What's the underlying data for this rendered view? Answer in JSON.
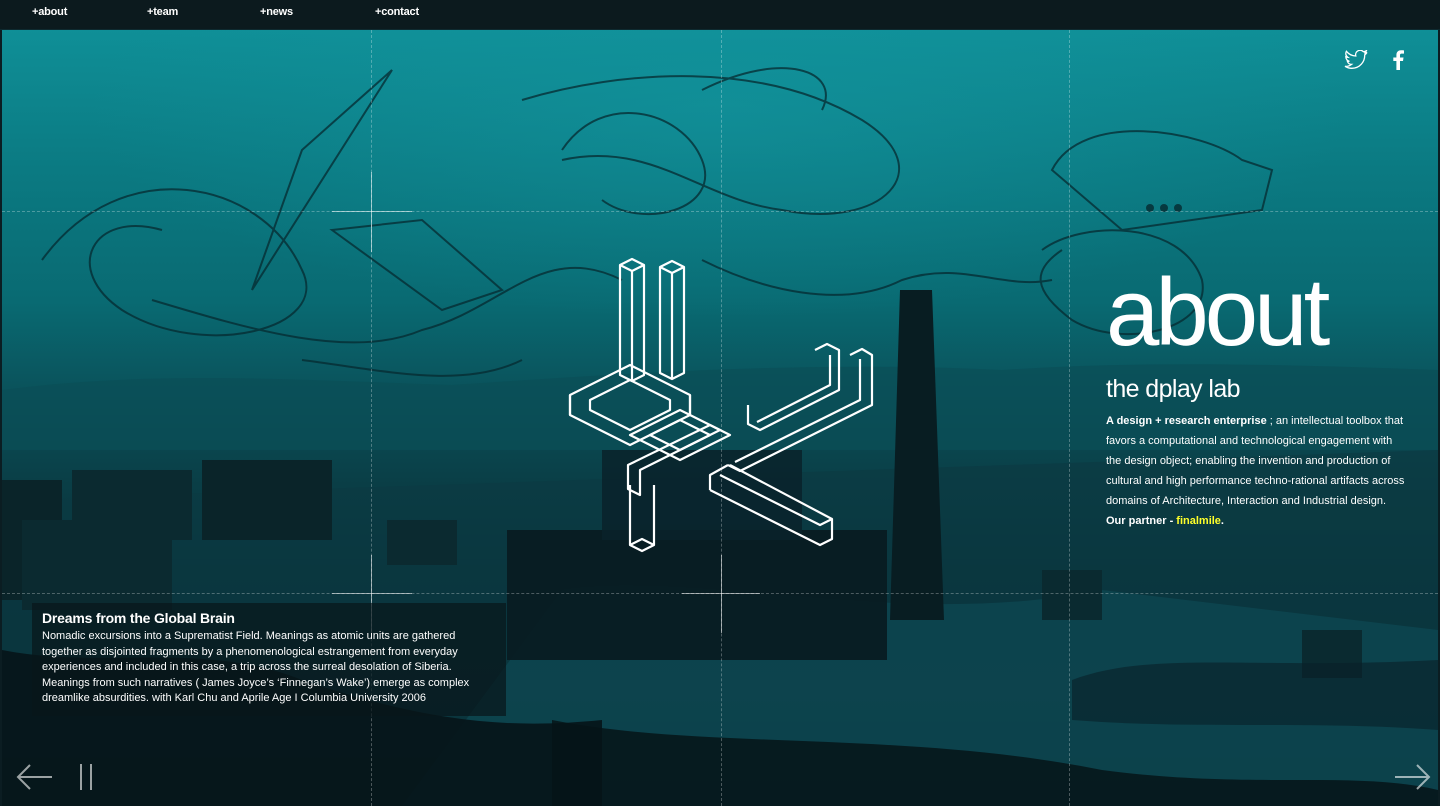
{
  "nav": {
    "items": [
      {
        "label": "+about"
      },
      {
        "label": "+team"
      },
      {
        "label": "+news"
      },
      {
        "label": "+contact"
      }
    ]
  },
  "social": {
    "icons": [
      "twitter-icon",
      "facebook-icon"
    ]
  },
  "about": {
    "heading": "about",
    "subheading": "the dplay lab",
    "lead": "A design + research enterprise",
    "text": " ; an intellectual toolbox that favors a computational and technological engagement with the design object; enabling the invention and production of cultural and high performance techno-rational artifacts across domains of Architecture, Interaction and Industrial design.",
    "partner_label": "Our partner - ",
    "partner_name": "finalmile",
    "partner_suffix": "."
  },
  "caption": {
    "title": "Dreams from the Global Brain",
    "body": "Nomadic excursions into a Suprematist Field. Meanings as atomic units are gathered together as disjointed fragments by a phenomenological estrangement from everyday experiences and included in this case, a trip across the surreal desolation of Siberia. Meanings from such narratives ( James Joyce’s ‘Finnegan’s Wake’) emerge as complex dreamlike absurdities. with Karl Chu and Aprile Age I Columbia University 2006"
  },
  "controls": {
    "prev": "arrow-left-icon",
    "pause": "pause-icon",
    "next": "arrow-right-icon"
  },
  "colors": {
    "accent_teal": "#0b8d96",
    "partner_yellow": "#ffff2a",
    "nav_bg": "#0c1a1e"
  }
}
